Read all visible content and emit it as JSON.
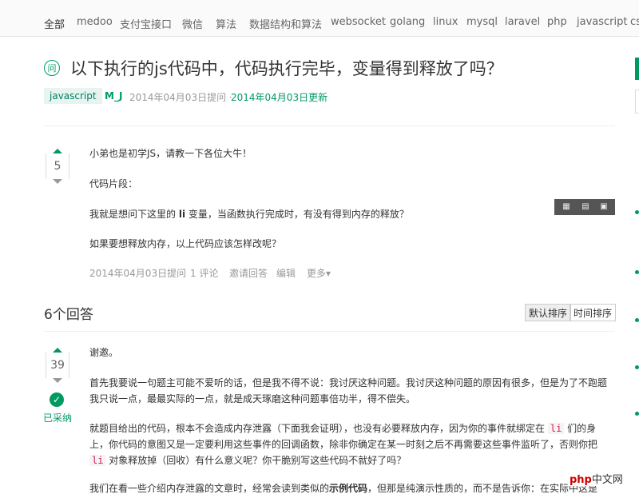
{
  "nav": [
    "全部",
    "medoo",
    "支付宝接口",
    "微信",
    "算法",
    "数据结构和算法",
    "websocket",
    "golang",
    "linux",
    "mysql",
    "laravel",
    "php",
    "javascript",
    "cs"
  ],
  "question": {
    "icon_text": "问",
    "title": "以下执行的js代码中，代码执行完毕，变量得到释放了吗？",
    "tag": "javascript",
    "author": "M_J",
    "asked": "2014年04月03日提问 ·",
    "updated": "2014年04月03日更新",
    "votes": "5",
    "p1": "小弟也是初学JS，请教一下各位大牛！",
    "p2": "代码片段：",
    "p3_before": "我就是想问下这里的",
    "p3_code": "li",
    "p3_after": "变量，当函数执行完成时，有没有得到内存的释放？",
    "p4": "如果要想释放内存，以上代码应该怎样改呢？",
    "actions": [
      "2014年04月03日提问",
      "1 评论",
      "邀请回答",
      "编辑",
      "更多▾"
    ]
  },
  "answers": {
    "count_label": "6个回答",
    "sort_default": "默认排序",
    "sort_time": "时间排序"
  },
  "answer1": {
    "votes": "39",
    "accepted": "已采纳",
    "p1": "谢邀。",
    "p2": "首先我要说一句题主可能不爱听的话，但是我不得不说：我讨厌这种问题。我讨厌这种问题的原因有很多，但是为了不跑题我只说一点，最最实际的一点，就是成天琢磨这种问题事倍功半，得不偿失。",
    "p3a": "就题目给出的代码，根本不会造成内存泄露（下面我会证明），也没有必要释放内存，因为你的事件就绑定在",
    "p3code": "li",
    "p3b": "们的身上，你代码的意图又是一定要利用这些事件的回调函数，除非你确定在某一时刻之后不再需要这些事件监听了，否则你把",
    "p3code2": "li",
    "p3c": "对象释放掉（回收）有什么意义呢？你干脆别写这些代码不就好了吗？",
    "p4a": "我们在看一些介绍内存泄露的文章时，经常会读到类似的",
    "p4bold": "示例代码",
    "p4b": "，但那是纯演示性质的，而不是告诉你：在实际中这是"
  },
  "watermark": {
    "brand": "php",
    "rest": "中文网"
  }
}
